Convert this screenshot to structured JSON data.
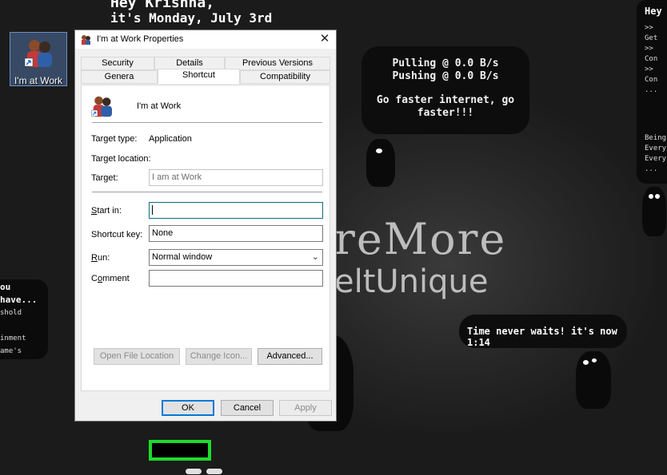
{
  "desktop": {
    "greeting": {
      "line1": "Hey Krishna,",
      "line2": "it's Monday, July 3rd"
    },
    "network": {
      "pulling": "Pulling @ 0.0 B/s",
      "pushing": "Pushing @ 0.0 B/s",
      "message": "Go faster internet, go faster!!!"
    },
    "time_message": "Time never waits! it's now 1:14",
    "brand_line1": "reMore",
    "brand_line2": "eltUnique",
    "right_panel": {
      "hey": "Hey",
      "lines": [
        ">> Get",
        ">> Con",
        ">> Con",
        "...",
        "Being",
        "Every",
        "Every",
        "..."
      ]
    },
    "left_panel": {
      "title": "ou have...",
      "lines": [
        "shold",
        "inment",
        "ame's"
      ]
    },
    "shortcut_icon_label": "I'm at Work"
  },
  "dialog": {
    "title": "I'm at Work Properties",
    "close_glyph": "✕",
    "tabs_row1": [
      "Security",
      "Details",
      "Previous Versions"
    ],
    "tabs_row2": [
      "Genera",
      "Shortcut",
      "Compatibility"
    ],
    "selected_tab": "Shortcut",
    "name": "I'm at Work",
    "target_type_label": "Target type:",
    "target_type_value": "Application",
    "target_location_label": "Target location:",
    "target_label": "Target:",
    "target_value": "I am at Work",
    "start_in_label": "Start in:",
    "start_in_value": "",
    "shortcut_key_label": "Shortcut key:",
    "shortcut_key_value": "None",
    "run_label": "Run:",
    "run_value": "Normal window",
    "comment_label": "Comment",
    "comment_value": "",
    "buttons": {
      "open_file_location": "Open File Location",
      "change_icon": "Change Icon...",
      "advanced": "Advanced...",
      "ok": "OK",
      "cancel": "Cancel",
      "apply": "Apply"
    }
  },
  "colors": {
    "focus_border": "#0b6e7d",
    "default_button": "#0078d7",
    "highlight_box": "#1cdc2a"
  }
}
